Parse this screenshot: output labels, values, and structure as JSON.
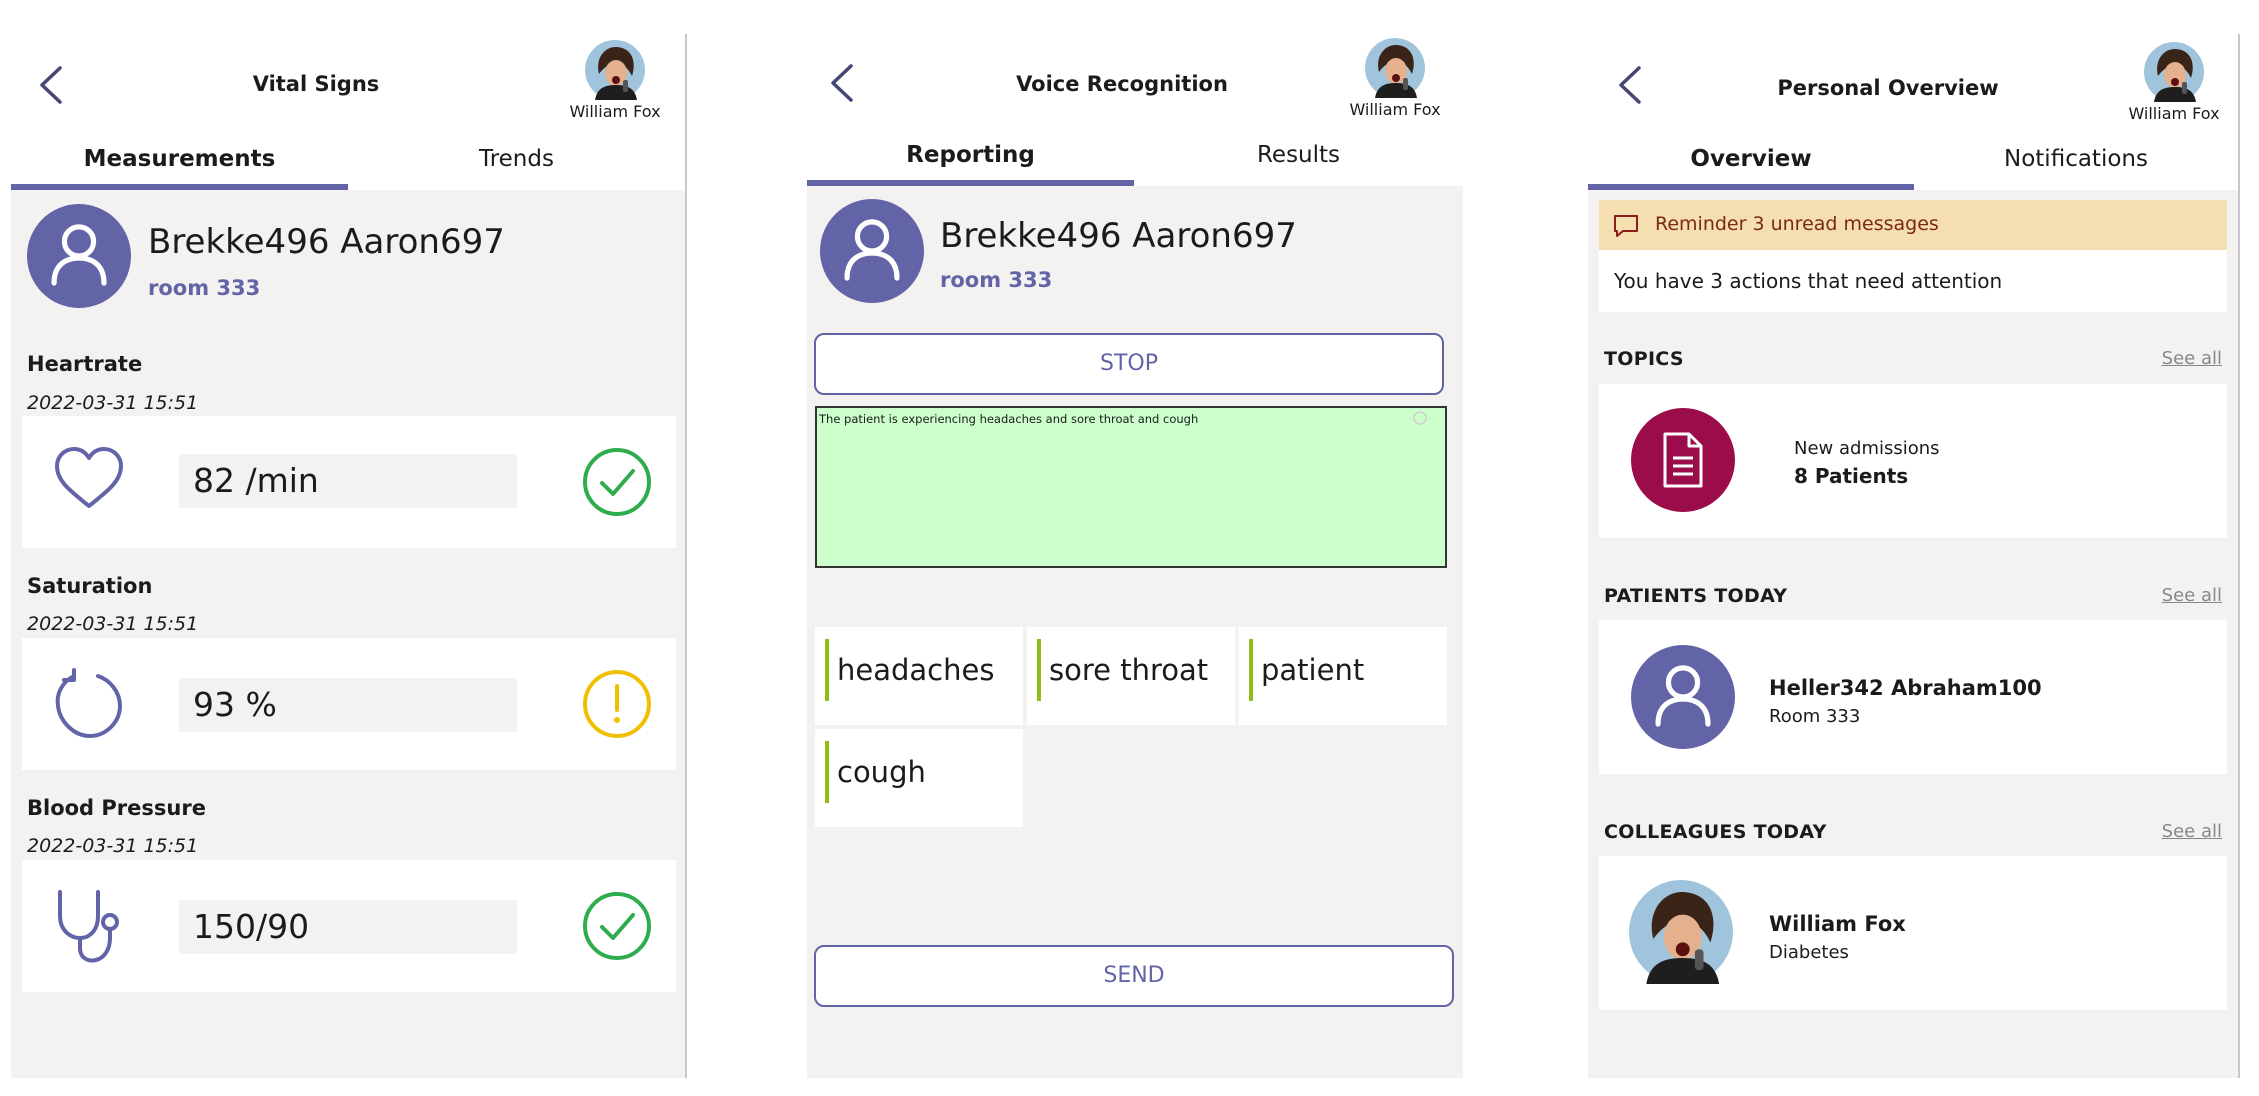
{
  "colors": {
    "accent": "#6264a7",
    "ok": "#2eac4e",
    "warn": "#f0c000",
    "topic": "#9b0c4b",
    "reminder_bg": "#f5deb0",
    "transcript_bg": "#ccffcc",
    "keyword_bar": "#8cbd18"
  },
  "user": {
    "name": "William Fox"
  },
  "vitals": {
    "title": "Vital Signs",
    "tabs": [
      "Measurements",
      "Trends"
    ],
    "patient": {
      "name": "Brekke496 Aaron697",
      "room": "room 333"
    },
    "measurements": [
      {
        "label": "Heartrate",
        "time": "2022-03-31 15:51",
        "value": "82 /min",
        "icon": "heart-icon",
        "status": "ok"
      },
      {
        "label": "Saturation",
        "time": "2022-03-31 15:51",
        "value": "93 %",
        "icon": "refresh-icon",
        "status": "warning"
      },
      {
        "label": "Blood Pressure",
        "time": "2022-03-31 15:51",
        "value": "150/90",
        "icon": "stethoscope-icon",
        "status": "ok"
      }
    ]
  },
  "voice": {
    "title": "Voice Recognition",
    "tabs": [
      "Reporting",
      "Results"
    ],
    "patient": {
      "name": "Brekke496 Aaron697",
      "room": "room 333"
    },
    "stop_label": "STOP",
    "transcript": "The patient is experiencing headaches and sore throat and cough",
    "keywords": [
      "headaches",
      "sore throat",
      "patient",
      "cough"
    ],
    "send_label": "SEND"
  },
  "overview": {
    "title": "Personal Overview",
    "tabs": [
      "Overview",
      "Notifications"
    ],
    "reminder": "Reminder 3 unread messages",
    "actions": "You have 3 actions that need attention",
    "see_all": "See all",
    "topics": {
      "heading": "TOPICS",
      "line1": "New admissions",
      "line2": "8 Patients"
    },
    "patients_today": {
      "heading": "PATIENTS TODAY",
      "name": "Heller342 Abraham100",
      "room": "Room 333"
    },
    "colleagues_today": {
      "heading": "COLLEAGUES TODAY",
      "name": "William Fox",
      "specialty": "Diabetes"
    }
  }
}
